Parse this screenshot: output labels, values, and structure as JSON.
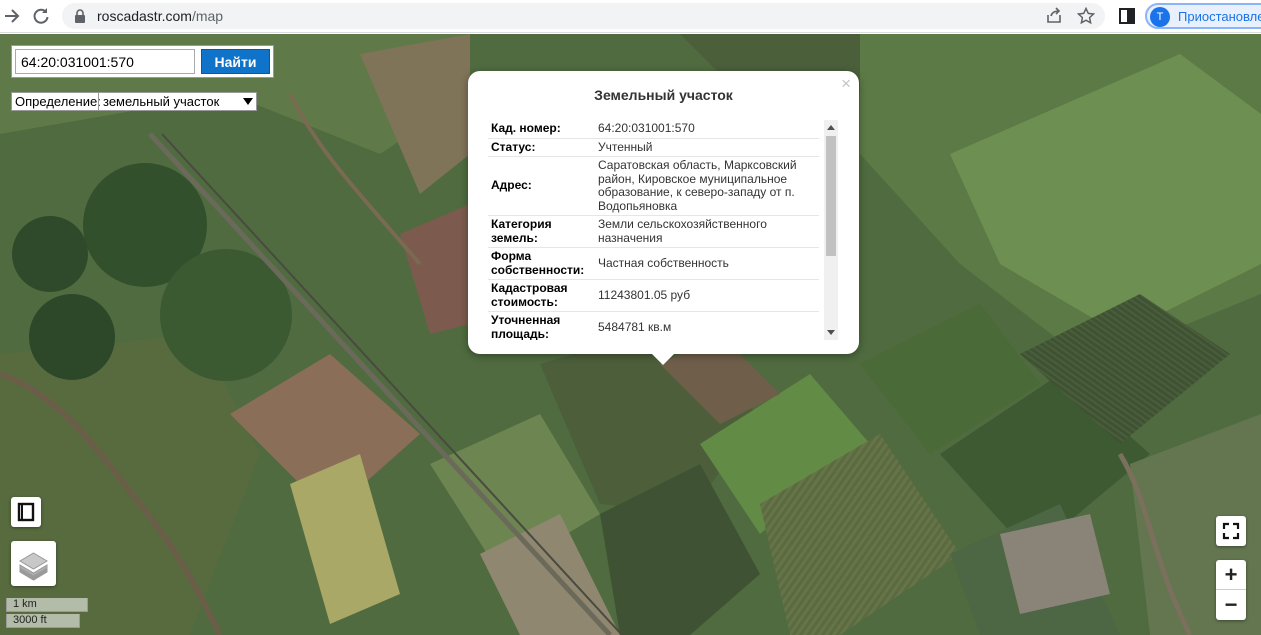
{
  "browser": {
    "url_domain": "roscadastr.com",
    "url_path": "/map",
    "profile_initial": "T",
    "profile_label": "Приостановлен"
  },
  "search": {
    "input_value": "64:20:031001:570",
    "button_label": "Найти"
  },
  "definition": {
    "label": "Определение:",
    "selected": "земельный участок"
  },
  "popup": {
    "title": "Земельный участок",
    "close_symbol": "×",
    "rows": [
      {
        "key": "Кад. номер:",
        "value": "64:20:031001:570"
      },
      {
        "key": "Статус:",
        "value": "Учтенный"
      },
      {
        "key": "Адрес:",
        "value": "Саратовская область, Марксовский район, Кировское муниципальное образование, к северо-западу от п. Водопьяновка"
      },
      {
        "key": "Категория земель:",
        "value": "Земли сельскохозяйственного назначения"
      },
      {
        "key": "Форма собственности:",
        "value": "Частная собственность"
      },
      {
        "key": "Кадастровая стоимость:",
        "value": "11243801.05 руб"
      },
      {
        "key": "Уточненная площадь:",
        "value": "5484781 кв.м"
      }
    ]
  },
  "controls": {
    "fullscreen_icon": "fullscreen-icon",
    "zoom_in": "+",
    "zoom_out": "−",
    "book_icon": "book-icon",
    "layers_icon": "layers-icon"
  },
  "scale": {
    "metric": "1 km",
    "imperial": "3000 ft"
  },
  "colors": {
    "search_button": "#0f74c9",
    "profile_accent": "#1a73e8"
  }
}
